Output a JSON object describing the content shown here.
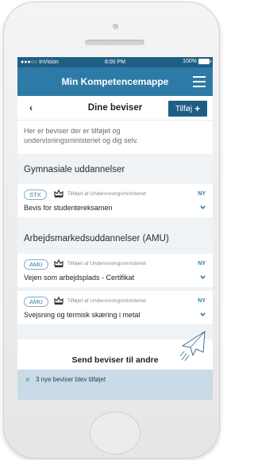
{
  "status_bar": {
    "carrier": "●●●○○ InVision",
    "time": "8:00 PM",
    "battery": "100%"
  },
  "nav": {
    "title": "Min Kompetencemappe",
    "menu_icon": "hamburger-icon"
  },
  "subheader": {
    "back_icon": "chevron-left-icon",
    "title": "Dine beviser",
    "add_label": "Tilføj"
  },
  "intro": "Her er beviser der er tilføjet og undervisningsministeriet og dig selv.",
  "sections": [
    {
      "title": "Gymnasiale uddannelser",
      "items": [
        {
          "badge": "STX",
          "added_by": "Tilføjet af Undervisningsministeriet",
          "flag": "NY",
          "title": "Bevis for studentereksamen"
        }
      ]
    },
    {
      "title": "Arbejdsmarkedsuddannelser (AMU)",
      "items": [
        {
          "badge": "AMU",
          "added_by": "Tilføjet af Undervisningsministeriet",
          "flag": "NY",
          "title": "Vejen som arbejdsplads - Certifikat"
        },
        {
          "badge": "AMU",
          "added_by": "Tilføjet af Undervisningsministeriet",
          "flag": "NY",
          "title": "Svejsning og termisk skæring i metal"
        }
      ]
    }
  ],
  "send": {
    "title": "Send beviser til andre",
    "icon": "paper-plane-icon"
  },
  "toast": {
    "close": "✕",
    "text": "3 nye beviser blev tilføjet"
  },
  "colors": {
    "status_bar": "#1f5e84",
    "nav": "#2d7aa6",
    "button": "#1f5e84",
    "toast": "#c9dbe6",
    "section_bg": "#f0f3f6"
  }
}
